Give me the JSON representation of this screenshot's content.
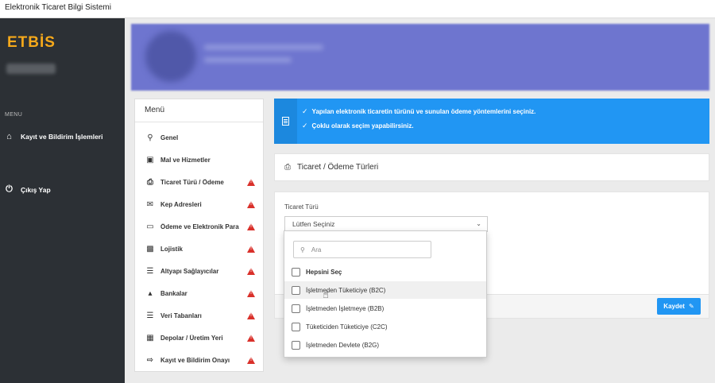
{
  "browser": {
    "title": "Elektronik Ticaret Bilgi Sistemi"
  },
  "sidebar": {
    "logo": "ETBİS",
    "section_label": "MENU",
    "items": [
      {
        "label": "Kayıt ve Bildirim İşlemleri",
        "icon": "home-icon"
      },
      {
        "label": "Çıkış Yap",
        "icon": "power-icon"
      }
    ]
  },
  "menu": {
    "title": "Menü",
    "items": [
      {
        "label": "Genel",
        "icon": "search-icon",
        "warning": false
      },
      {
        "label": "Mal ve Hizmetler",
        "icon": "basket-icon",
        "warning": false
      },
      {
        "label": "Ticaret Türü / Ödeme",
        "icon": "clipboard-icon",
        "warning": true
      },
      {
        "label": "Kep Adresleri",
        "icon": "envelope-icon",
        "warning": true
      },
      {
        "label": "Ödeme ve Elektronik Para",
        "icon": "credit-card-icon",
        "warning": true
      },
      {
        "label": "Lojistik",
        "icon": "bus-icon",
        "warning": true
      },
      {
        "label": "Altyapı Sağlayıcılar",
        "icon": "server-icon",
        "warning": true
      },
      {
        "label": "Bankalar",
        "icon": "bank-icon",
        "warning": true
      },
      {
        "label": "Veri Tabanları",
        "icon": "database-icon",
        "warning": true
      },
      {
        "label": "Depolar / Üretim Yeri",
        "icon": "building-icon",
        "warning": true
      },
      {
        "label": "Kayıt ve Bildirim Onayı",
        "icon": "sign-out-icon",
        "warning": true
      }
    ]
  },
  "info": {
    "lines": [
      "Yapılan elektronik ticaretin türünü ve sunulan ödeme yöntemlerini seçiniz.",
      "Çoklu olarak seçim yapabilirsiniz."
    ]
  },
  "section": {
    "title": "Ticaret / Ödeme Türleri"
  },
  "form": {
    "field_label": "Ticaret Türü",
    "select_value": "Lütfen Seçiniz",
    "save_label": "Kaydet"
  },
  "dropdown": {
    "search_placeholder": "Ara",
    "options": [
      {
        "label": "Hepsini Seç",
        "checked": false
      },
      {
        "label": "İşletmeden Tüketiciye (B2C)",
        "checked": false
      },
      {
        "label": "İşletmeden İşletmeye (B2B)",
        "checked": false
      },
      {
        "label": "Tüketiciden Tüketiciye (C2C)",
        "checked": false
      },
      {
        "label": "İşletmeden Devlete (B2G)",
        "checked": false
      }
    ]
  },
  "colors": {
    "accent": "#2196f3",
    "logo": "#f6a91b",
    "sidebar": "#2c3035",
    "warning": "#d9302a"
  }
}
